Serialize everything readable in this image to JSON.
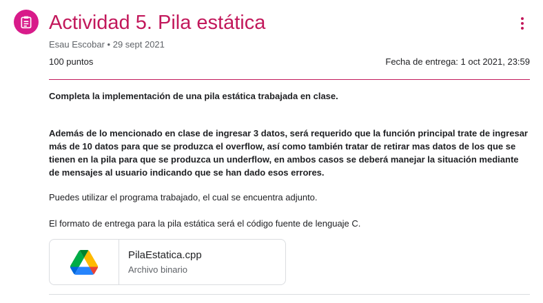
{
  "colors": {
    "accent": "#c2185b",
    "icon_bg": "#d81b8a",
    "divider": "#dadce0"
  },
  "header": {
    "icon": "assignment-icon",
    "title": "Actividad 5. Pila estática",
    "meta": "Esau Escobar • 29 sept 2021",
    "points": "100 puntos",
    "due": "Fecha de entrega: 1 oct 2021, 23:59",
    "more_icon": "more-vert-icon"
  },
  "body": {
    "p1": "Completa la implementación de una pila estática trabajada en clase.",
    "p2": "Además de lo mencionado en clase de ingresar 3 datos, será requerido que la función principal trate de ingresar más de 10 datos para que se produzca el overflow, así como también tratar de retirar mas datos de los que se tienen en la pila para que se produzca un underflow, en ambos casos se deberá manejar la situación mediante de mensajes al usuario indicando que se han dado esos errores.",
    "p3": "Puedes utilizar el programa trabajado, el cual se encuentra adjunto.",
    "p4": "El formato de entrega para la pila estática será el código fuente de lenguaje C."
  },
  "attachment": {
    "icon": "google-drive-icon",
    "name": "PilaEstatica.cpp",
    "type": "Archivo binario"
  }
}
